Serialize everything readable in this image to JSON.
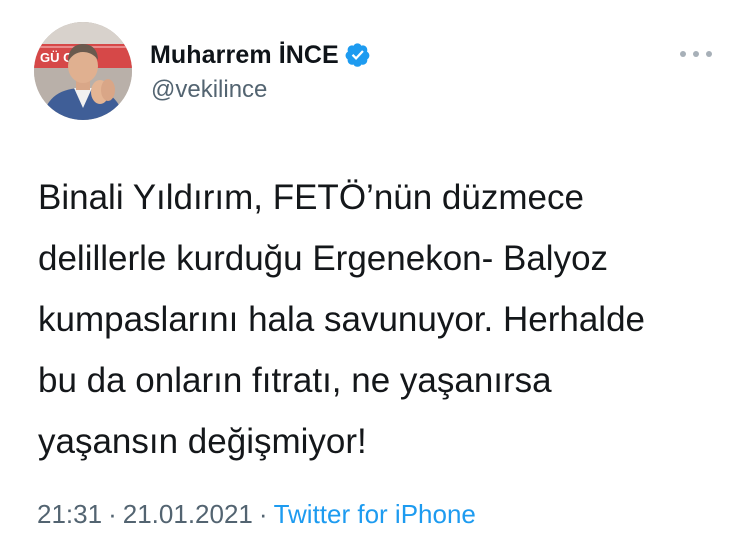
{
  "author": {
    "display_name": "Muharrem İNCE",
    "handle": "@vekilince",
    "verified": true,
    "avatar_sign_text": "GÜ  CE",
    "avatar_icon": "user-photo"
  },
  "tweet": {
    "lines": [
      "Binali Yıldırım, FETÖ’nün düzmece",
      "delillerle kurduğu Ergenekon- Balyoz",
      "kumpaslarını hala savunuyor. Herhalde",
      "bu da onların fıtratı, ne yaşanırsa",
      "yaşansın değişmiyor!"
    ]
  },
  "meta": {
    "time": "21:31",
    "separator": "·",
    "date": "21.01.2021",
    "source": "Twitter for iPhone"
  },
  "icons": {
    "verified": "verified-badge-icon",
    "more": "more-options-icon"
  },
  "colors": {
    "verified_blue": "#1d9bf0",
    "secondary_text": "#536471",
    "link_blue": "#1d9bf0",
    "primary_text": "#0f1419"
  }
}
